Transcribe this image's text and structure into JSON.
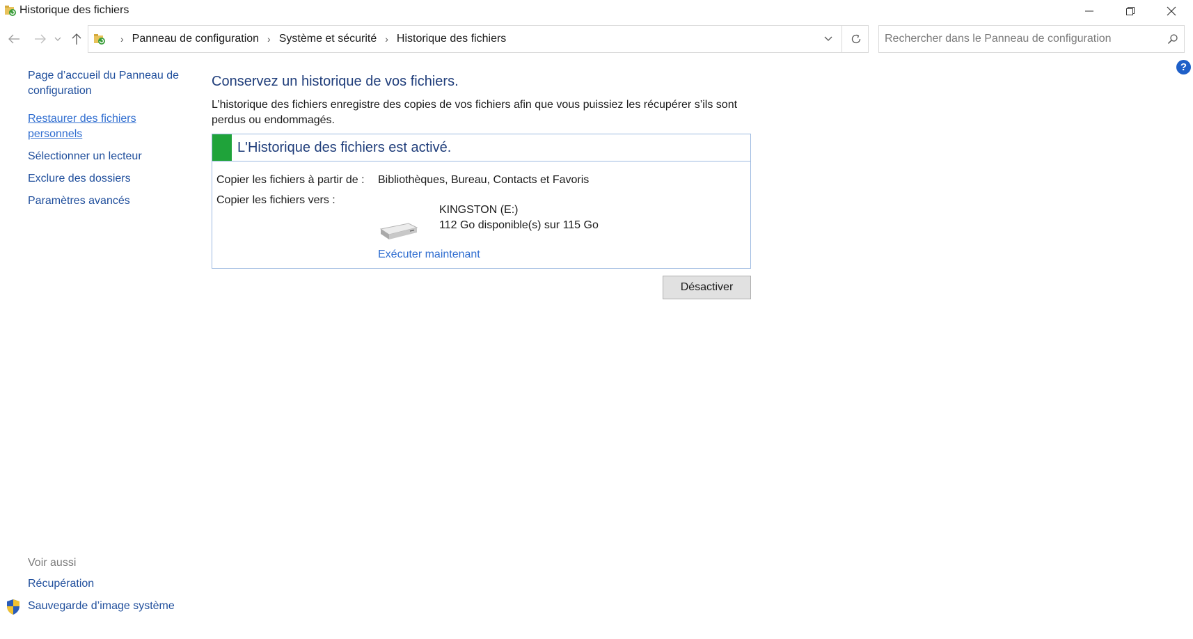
{
  "window": {
    "title": "Historique des fichiers"
  },
  "address": {
    "breadcrumbs": [
      "Panneau de configuration",
      "Système et sécurité",
      "Historique des fichiers"
    ]
  },
  "search": {
    "placeholder": "Rechercher dans le Panneau de configuration"
  },
  "help": {
    "label": "?"
  },
  "sidebar": {
    "items": [
      {
        "label": "Page d’accueil du Panneau de configuration"
      },
      {
        "label": "Restaurer des fichiers personnels"
      },
      {
        "label": "Sélectionner un lecteur"
      },
      {
        "label": "Exclure des dossiers"
      },
      {
        "label": "Paramètres avancés"
      }
    ],
    "see_also": {
      "title": "Voir aussi",
      "items": [
        {
          "label": "Récupération"
        },
        {
          "label": "Sauvegarde d’image système"
        }
      ]
    }
  },
  "main": {
    "title": "Conservez un historique de vos fichiers.",
    "description": "L’historique des fichiers enregistre des copies de vos fichiers afin que vous puissiez les récupérer s’ils sont perdus ou endommagés.",
    "status": {
      "text": "L'Historique des fichiers est activé.",
      "color": "#1fa33a"
    },
    "copy_from_label": "Copier les fichiers à partir de :",
    "copy_from_value": "Bibliothèques, Bureau, Contacts et Favoris",
    "copy_to_label": "Copier les fichiers vers :",
    "drive_name": "KINGSTON (E:)",
    "drive_space": "112 Go disponible(s) sur 115 Go",
    "run_now": "Exécuter maintenant",
    "disable_button": "Désactiver"
  }
}
